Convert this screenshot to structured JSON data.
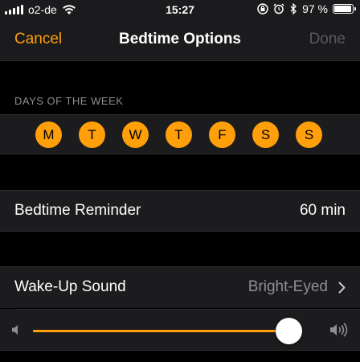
{
  "status_bar": {
    "carrier": "o2-de",
    "time": "15:27",
    "battery_percent": "97 %",
    "battery_level": 0.97,
    "icons": [
      "signal-icon",
      "wifi-icon",
      "orientation-lock-icon",
      "alarm-icon",
      "bluetooth-icon",
      "battery-icon"
    ]
  },
  "nav": {
    "cancel_label": "Cancel",
    "title": "Bedtime Options",
    "done_label": "Done"
  },
  "days_section": {
    "header": "DAYS OF THE WEEK",
    "days": [
      "M",
      "T",
      "W",
      "T",
      "F",
      "S",
      "S"
    ],
    "selected": [
      true,
      true,
      true,
      true,
      true,
      true,
      true
    ]
  },
  "reminder": {
    "label": "Bedtime Reminder",
    "value": "60 min"
  },
  "wake_sound": {
    "label": "Wake-Up Sound",
    "value": "Bright-Eyed",
    "volume_level": 1.0
  },
  "colors": {
    "accent": "#ff9f0a",
    "background": "#000000",
    "cell": "#1c1c1e",
    "disabled": "#5a5a5e",
    "secondary_text": "#8e8e93"
  }
}
